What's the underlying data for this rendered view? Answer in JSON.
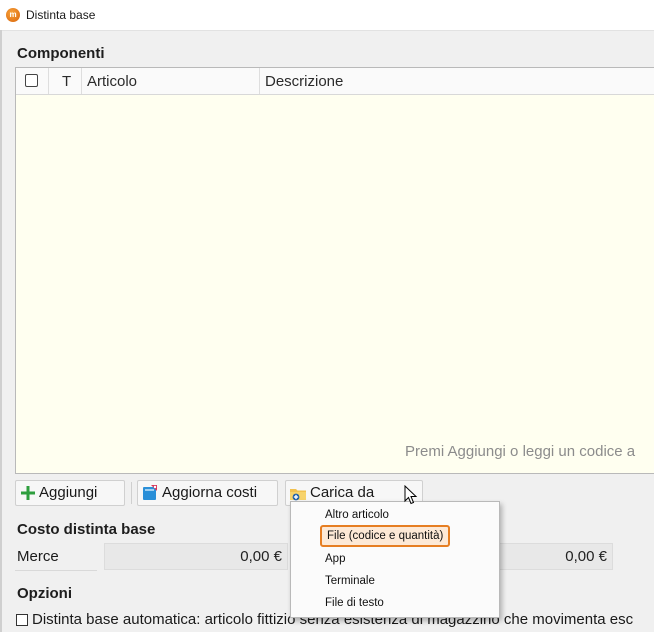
{
  "window": {
    "title": "Distinta base",
    "icon": "app-logo-icon"
  },
  "components": {
    "section_title": "Componenti",
    "columns": [
      "T",
      "Articolo",
      "Descrizione"
    ],
    "placeholder": "Premi Aggiungi o leggi un codice a"
  },
  "toolbar": {
    "add_label": "Aggiungi",
    "update_costs_label": "Aggiorna costi",
    "load_from_label": "Carica da"
  },
  "cost": {
    "section_title": "Costo distinta base",
    "goods_label": "Merce",
    "goods_value": "0,00 €",
    "second_value": "0,00 €"
  },
  "options": {
    "section_title": "Opzioni",
    "automatic_label": "Distinta base automatica: articolo fittizio senza esistenza di magazzino che movimenta esc"
  },
  "load_menu": {
    "items": [
      "Altro articolo",
      "File (codice e quantità)",
      "App",
      "Terminale",
      "File di testo"
    ],
    "selected": "File (codice e quantità)"
  },
  "colors": {
    "grid_background": "#fffff0",
    "highlight": "#e67e22",
    "add_icon": "#2e9e3e"
  }
}
